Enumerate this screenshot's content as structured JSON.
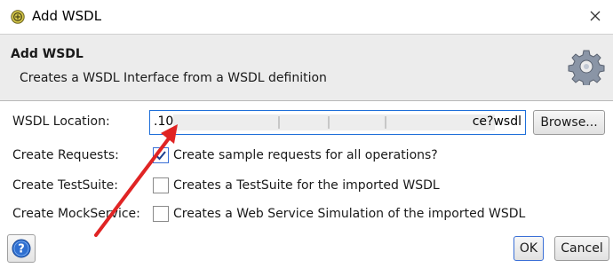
{
  "window": {
    "title": "Add WSDL",
    "icon": "soapui-app-icon",
    "close_icon": "close-icon"
  },
  "header": {
    "title": "Add WSDL",
    "description": "Creates a WSDL Interface from a WSDL definition",
    "icon": "gear-icon"
  },
  "form": {
    "wsdl_location": {
      "label": "WSDL Location:",
      "value_prefix": ".10",
      "value_suffix": "ce?wsdl",
      "browse_label": "Browse..."
    },
    "create_requests": {
      "label": "Create Requests:",
      "checkbox_label": "Create sample requests for all operations?",
      "checked": true
    },
    "create_testsuite": {
      "label": "Create TestSuite:",
      "checkbox_label": "Creates a TestSuite for the imported WSDL",
      "checked": false
    },
    "create_mockservice": {
      "label": "Create MockService:",
      "checkbox_label": "Creates a Web Service Simulation of the imported WSDL",
      "checked": false
    }
  },
  "footer": {
    "help_icon": "help-icon",
    "ok_label": "OK",
    "cancel_label": "Cancel"
  },
  "colors": {
    "header_bg": "#ececec",
    "focus_border": "#1e6fd9",
    "annotation_arrow": "#e02424"
  }
}
